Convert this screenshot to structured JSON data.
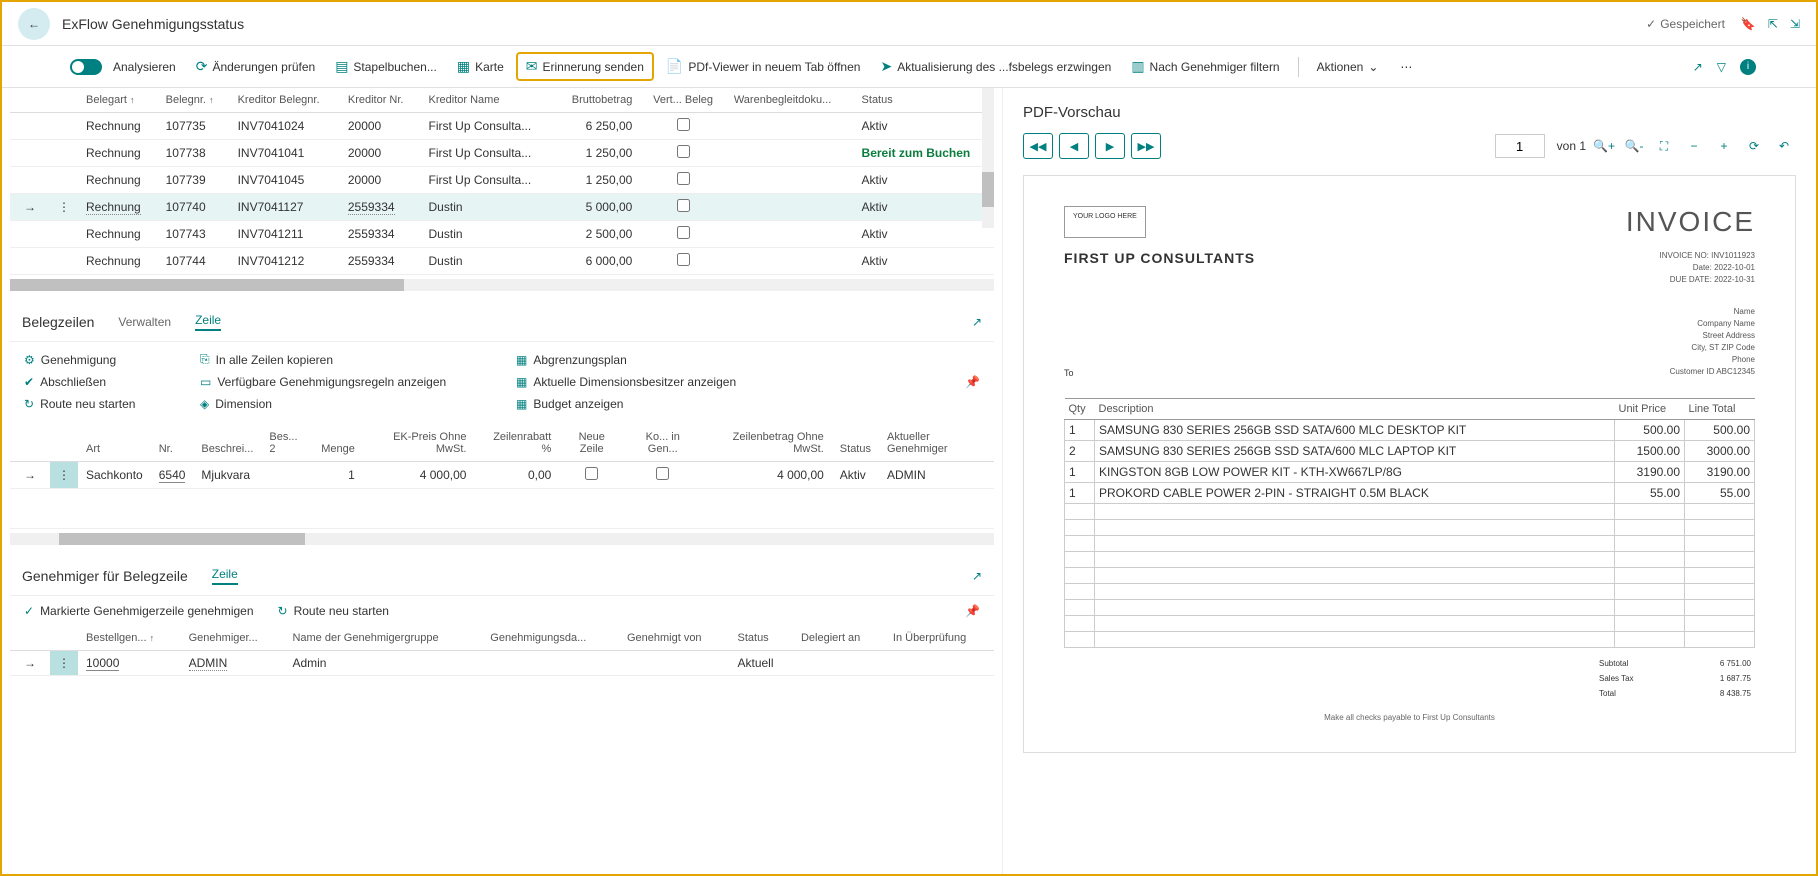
{
  "header": {
    "title": "ExFlow Genehmigungsstatus",
    "saved": "Gespeichert"
  },
  "toolbar": {
    "analyze": "Analysieren",
    "check_changes": "Änderungen prüfen",
    "batch_book": "Stapelbuchen...",
    "card": "Karte",
    "send_reminder": "Erinnerung senden",
    "pdf_new_tab": "PDf-Viewer in neuem Tab öffnen",
    "force_update": "Aktualisierung des ...fsbelegs erzwingen",
    "filter_approver": "Nach Genehmiger filtern",
    "actions": "Aktionen"
  },
  "main_table": {
    "headers": {
      "doc_type": "Belegart",
      "doc_no": "Belegnr.",
      "creditor_doc_no": "Kreditor Belegnr.",
      "creditor_no": "Kreditor Nr.",
      "creditor_name": "Kreditor Name",
      "gross": "Bruttobetrag",
      "conf_doc": "Vert... Beleg",
      "goods_doc": "Warenbegleitdoku...",
      "status": "Status"
    },
    "rows": [
      {
        "type": "Rechnung",
        "no": "107735",
        "cdoc": "INV7041024",
        "cno": "20000",
        "cname": "First Up Consulta...",
        "gross": "6 250,00",
        "status": "Aktiv"
      },
      {
        "type": "Rechnung",
        "no": "107738",
        "cdoc": "INV7041041",
        "cno": "20000",
        "cname": "First Up Consulta...",
        "gross": "1 250,00",
        "status": "Bereit zum Buchen",
        "ready": true
      },
      {
        "type": "Rechnung",
        "no": "107739",
        "cdoc": "INV7041045",
        "cno": "20000",
        "cname": "First Up Consulta...",
        "gross": "1 250,00",
        "status": "Aktiv"
      },
      {
        "type": "Rechnung",
        "no": "107740",
        "cdoc": "INV7041127",
        "cno": "2559334",
        "cname": "Dustin",
        "gross": "5 000,00",
        "status": "Aktiv",
        "selected": true,
        "dotted": true
      },
      {
        "type": "Rechnung",
        "no": "107743",
        "cdoc": "INV7041211",
        "cno": "2559334",
        "cname": "Dustin",
        "gross": "2 500,00",
        "status": "Aktiv"
      },
      {
        "type": "Rechnung",
        "no": "107744",
        "cdoc": "INV7041212",
        "cno": "2559334",
        "cname": "Dustin",
        "gross": "6 000,00",
        "status": "Aktiv"
      }
    ]
  },
  "doc_lines": {
    "title": "Belegzeilen",
    "manage": "Verwalten",
    "line": "Zeile",
    "actions": {
      "approval": "Genehmigung",
      "complete": "Abschließen",
      "restart_route": "Route neu starten",
      "copy_all": "In alle Zeilen kopieren",
      "show_rules": "Verfügbare Genehmigungsregeln anzeigen",
      "dimension": "Dimension",
      "accrual": "Abgrenzungsplan",
      "dim_owners": "Aktuelle Dimensionsbesitzer anzeigen",
      "budget": "Budget anzeigen"
    },
    "headers": {
      "type": "Art",
      "no": "Nr.",
      "desc": "Beschrei...",
      "desc2": "Bes... 2",
      "qty": "Menge",
      "unit_price": "EK-Preis Ohne MwSt.",
      "discount": "Zeilenrabatt %",
      "new_line": "Neue Zeile",
      "ko_in_gen": "Ko... in Gen...",
      "line_amount": "Zeilenbetrag Ohne MwSt.",
      "status": "Status",
      "current_approver": "Aktueller Genehmiger"
    },
    "row": {
      "type": "Sachkonto",
      "no": "6540",
      "desc": "Mjukvara",
      "qty": "1",
      "unit_price": "4 000,00",
      "discount": "0,00",
      "line_amount": "4 000,00",
      "status": "Aktiv",
      "approver": "ADMIN"
    }
  },
  "approvers": {
    "title": "Genehmiger für Belegzeile",
    "line": "Zeile",
    "approve_marked": "Markierte Genehmigerzeile genehmigen",
    "restart_route": "Route neu starten",
    "headers": {
      "order": "Bestellgen...",
      "approver": "Genehmiger...",
      "group_name": "Name der Genehmigergruppe",
      "approval_da": "Genehmigungsda...",
      "approved_by": "Genehmigt von",
      "status": "Status",
      "delegated_to": "Delegiert an",
      "in_review": "In Überprüfung"
    },
    "row": {
      "order": "10000",
      "approver": "ADMIN",
      "group_name": "Admin",
      "status": "Aktuell"
    }
  },
  "pdf": {
    "title": "PDF-Vorschau",
    "page": "1",
    "of": "von 1",
    "invoice": {
      "logo": "YOUR LOGO HERE",
      "title": "INVOICE",
      "company": "FIRST UP CONSULTANTS",
      "no": "INVOICE NO: INV1011923",
      "date": "Date: 2022-10-01",
      "due": "DUE DATE: 2022-10-31",
      "to": "To",
      "to_name": "Name",
      "to_company": "Company Name",
      "to_street": "Street Address",
      "to_city": "City, ST ZIP Code",
      "to_phone": "Phone",
      "to_customer": "Customer ID ABC12345",
      "th_qty": "Qty",
      "th_desc": "Description",
      "th_unit": "Unit Price",
      "th_total": "Line Total",
      "items": [
        {
          "qty": "1",
          "desc": "SAMSUNG 830 SERIES 256GB SSD SATA/600 MLC DESKTOP KIT",
          "unit": "500.00",
          "total": "500.00"
        },
        {
          "qty": "2",
          "desc": "SAMSUNG 830 SERIES 256GB SSD SATA/600 MLC LAPTOP KIT",
          "unit": "1500.00",
          "total": "3000.00"
        },
        {
          "qty": "1",
          "desc": "KINGSTON 8GB LOW POWER KIT - KTH-XW667LP/8G",
          "unit": "3190.00",
          "total": "3190.00"
        },
        {
          "qty": "1",
          "desc": "PROKORD CABLE POWER 2-PIN - STRAIGHT 0.5M BLACK",
          "unit": "55.00",
          "total": "55.00"
        }
      ],
      "subtotal_l": "Subtotal",
      "subtotal_v": "6 751.00",
      "tax_l": "Sales Tax",
      "tax_v": "1 687.75",
      "total_l": "Total",
      "total_v": "8 438.75",
      "footer": "Make all checks payable to First Up Consultants"
    }
  }
}
